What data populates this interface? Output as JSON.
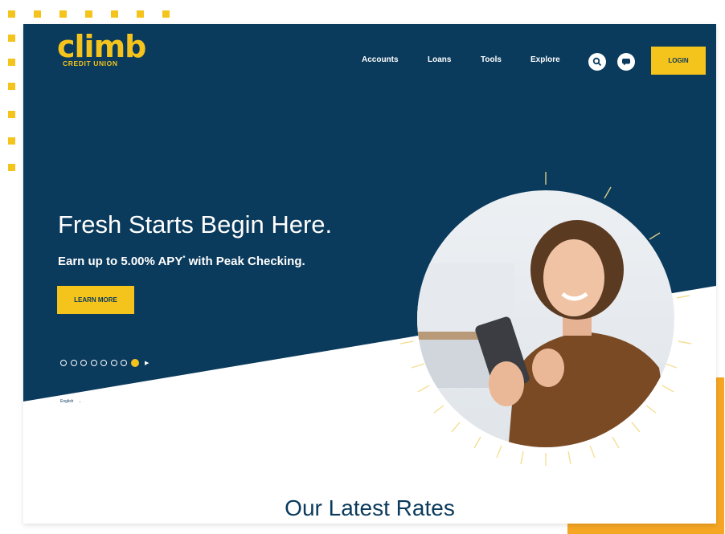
{
  "brand": {
    "name": "climb",
    "tagline": "CREDIT UNION",
    "primary_color": "#0a3a5c",
    "accent_color": "#f4c41d"
  },
  "nav": {
    "items": [
      {
        "label": "Accounts"
      },
      {
        "label": "Loans"
      },
      {
        "label": "Tools"
      },
      {
        "label": "Explore"
      }
    ],
    "search_icon": "search-icon",
    "chat_icon": "chat-icon",
    "login_label": "LOGIN"
  },
  "hero": {
    "headline": "Fresh Starts Begin Here.",
    "subhead_main": "Earn up to 5.00% APY",
    "subhead_sup": "*",
    "subhead_tail": " with Peak Checking.",
    "cta_label": "LEARN MORE",
    "carousel": {
      "slides": 8,
      "active_slide": 8,
      "play_icon": "play-icon"
    }
  },
  "language": {
    "label": "English",
    "icon": "chevron-down-icon"
  },
  "rates": {
    "title": "Our Latest Rates"
  }
}
